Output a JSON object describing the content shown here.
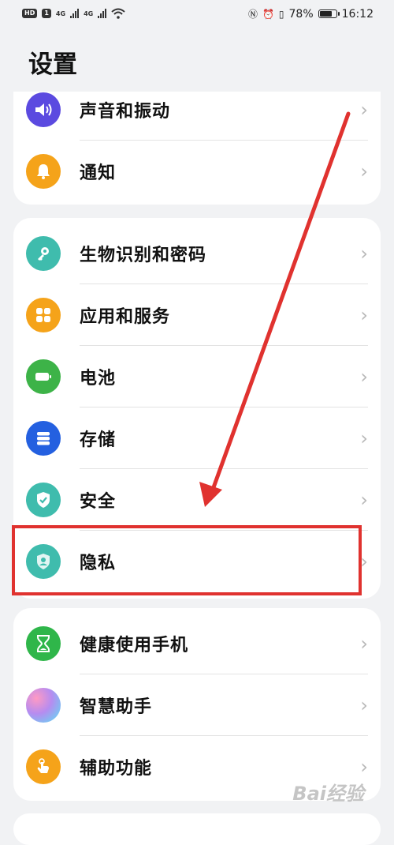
{
  "status_bar": {
    "left_badges": [
      "HD",
      "1",
      "4G",
      "4G"
    ],
    "battery_text": "78%",
    "battery_level": 0.78,
    "time": "16:12"
  },
  "page_title": "设置",
  "groups": [
    [
      {
        "label": "声音和振动",
        "icon": "volume-icon"
      },
      {
        "label": "通知",
        "icon": "bell-icon"
      }
    ],
    [
      {
        "label": "生物识别和密码",
        "icon": "key-icon"
      },
      {
        "label": "应用和服务",
        "icon": "apps-grid-icon"
      },
      {
        "label": "电池",
        "icon": "battery-icon"
      },
      {
        "label": "存储",
        "icon": "storage-icon"
      },
      {
        "label": "安全",
        "icon": "shield-check-icon"
      },
      {
        "label": "隐私",
        "icon": "privacy-shield-icon"
      }
    ],
    [
      {
        "label": "健康使用手机",
        "icon": "hourglass-icon"
      },
      {
        "label": "智慧助手",
        "icon": "assistant-orb-icon"
      },
      {
        "label": "辅助功能",
        "icon": "hand-touch-icon"
      }
    ]
  ],
  "chevron": "›",
  "watermark": "Bai经验",
  "annotation_color": "#e0322f"
}
